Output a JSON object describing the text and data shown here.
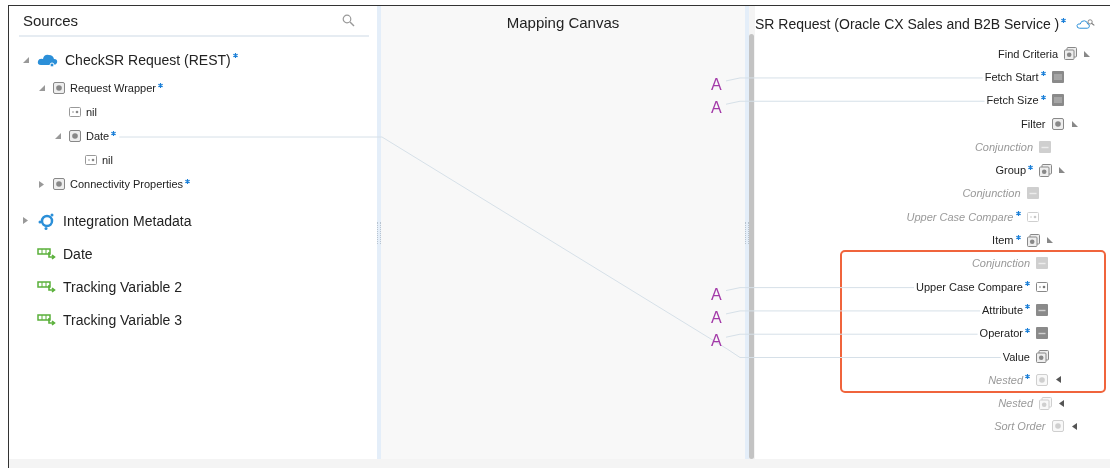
{
  "sources": {
    "title": "Sources",
    "items": [
      {
        "label": "CheckSR Request (REST)",
        "kind": "cloud",
        "required": true,
        "expanded": true,
        "children": [
          {
            "label": "Request Wrapper",
            "kind": "object",
            "required": true,
            "expanded": true,
            "children": [
              {
                "label": "nil",
                "kind": "boolean"
              },
              {
                "label": "Date",
                "kind": "object",
                "required": true,
                "expanded": true,
                "mapped": true,
                "children": [
                  {
                    "label": "nil",
                    "kind": "boolean"
                  }
                ]
              }
            ]
          },
          {
            "label": "Connectivity Properties",
            "kind": "object",
            "required": true,
            "expanded": false
          }
        ]
      },
      {
        "label": "Integration Metadata",
        "kind": "integration",
        "expanded": false
      },
      {
        "label": "Date",
        "kind": "tracking"
      },
      {
        "label": "Tracking Variable 2",
        "kind": "tracking"
      },
      {
        "label": "Tracking Variable 3",
        "kind": "tracking"
      }
    ]
  },
  "canvas": {
    "title": "Mapping Canvas"
  },
  "target": {
    "title": "SR Request (Oracle CX Sales and B2B Service )",
    "required": true,
    "items": [
      {
        "label": "Find Criteria",
        "kind": "object-list",
        "expanded": true,
        "children": [
          {
            "label": "Fetch Start",
            "kind": "number",
            "required": true,
            "mapping": {
              "kind": "literal",
              "text": "A"
            }
          },
          {
            "label": "Fetch Size",
            "kind": "number",
            "required": true,
            "mapping": {
              "kind": "literal",
              "text": "A"
            }
          },
          {
            "label": "Filter",
            "kind": "object",
            "expanded": true,
            "children": [
              {
                "label": "Conjunction",
                "kind": "string",
                "greyed": true
              },
              {
                "label": "Group",
                "kind": "object-list",
                "required": true,
                "expanded": true,
                "children": [
                  {
                    "label": "Conjunction",
                    "kind": "string",
                    "greyed": true
                  },
                  {
                    "label": "Upper Case Compare",
                    "kind": "boolean",
                    "required": true,
                    "greyed": true
                  },
                  {
                    "label": "Item",
                    "kind": "object-list",
                    "required": true,
                    "expanded": true,
                    "highlighted": true,
                    "children": [
                      {
                        "label": "Conjunction",
                        "kind": "string",
                        "greyed": true
                      },
                      {
                        "label": "Upper Case Compare",
                        "kind": "boolean",
                        "required": true,
                        "mapping": {
                          "kind": "literal",
                          "text": "A"
                        }
                      },
                      {
                        "label": "Attribute",
                        "kind": "string",
                        "required": true,
                        "mapping": {
                          "kind": "literal",
                          "text": "A"
                        }
                      },
                      {
                        "label": "Operator",
                        "kind": "string",
                        "required": true,
                        "mapping": {
                          "kind": "literal",
                          "text": "A"
                        }
                      },
                      {
                        "label": "Value",
                        "kind": "object-list",
                        "mapping": {
                          "kind": "source"
                        }
                      },
                      {
                        "label": "Nested",
                        "kind": "object",
                        "required": true,
                        "greyed": true,
                        "expanded": false
                      }
                    ]
                  }
                ]
              },
              {
                "label": "Nested",
                "kind": "object-list",
                "greyed": true,
                "expanded": false
              }
            ]
          },
          {
            "label": "Sort Order",
            "kind": "object",
            "greyed": true,
            "expanded": false
          }
        ]
      }
    ]
  }
}
